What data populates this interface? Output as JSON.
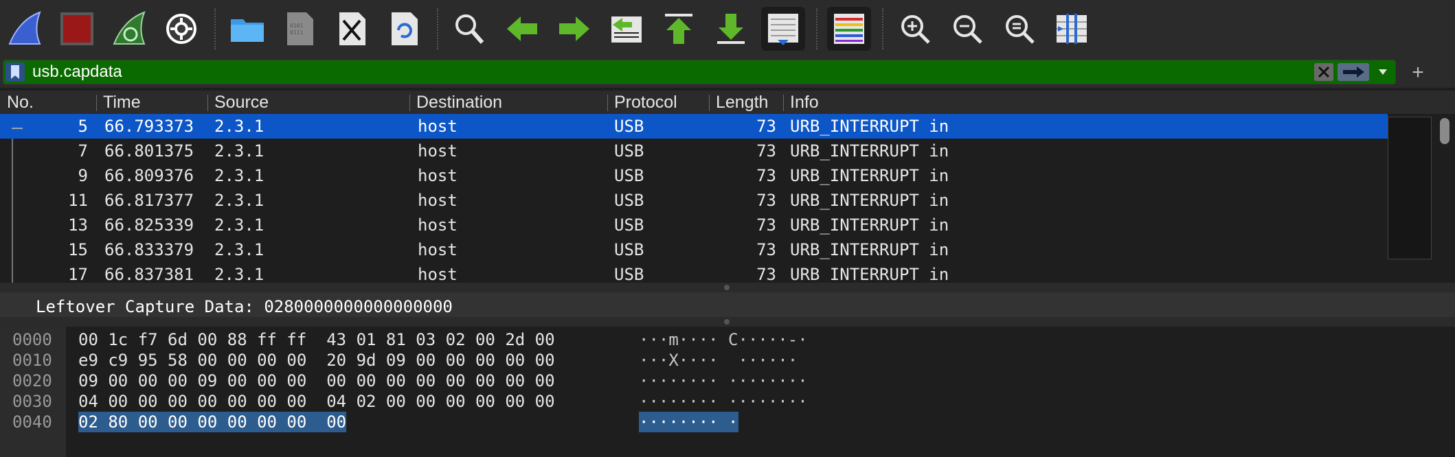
{
  "toolbar": {
    "buttons": [
      {
        "name": "start-capture-icon",
        "label": "Start capture"
      },
      {
        "name": "stop-capture-icon",
        "label": "Stop capture"
      },
      {
        "name": "restart-capture-icon",
        "label": "Restart capture"
      },
      {
        "name": "capture-options-icon",
        "label": "Capture options"
      },
      {
        "name": "open-file-icon",
        "label": "Open"
      },
      {
        "name": "save-file-icon",
        "label": "Save"
      },
      {
        "name": "close-file-icon",
        "label": "Close"
      },
      {
        "name": "reload-file-icon",
        "label": "Reload"
      },
      {
        "name": "find-packet-icon",
        "label": "Find packet"
      },
      {
        "name": "go-back-icon",
        "label": "Previous"
      },
      {
        "name": "go-forward-icon",
        "label": "Next"
      },
      {
        "name": "go-to-packet-icon",
        "label": "Go to packet"
      },
      {
        "name": "go-first-icon",
        "label": "First packet"
      },
      {
        "name": "go-last-icon",
        "label": "Last packet"
      },
      {
        "name": "autoscroll-icon",
        "label": "Auto scroll"
      },
      {
        "name": "colorize-icon",
        "label": "Colorize"
      },
      {
        "name": "zoom-in-icon",
        "label": "Zoom in"
      },
      {
        "name": "zoom-out-icon",
        "label": "Zoom out"
      },
      {
        "name": "zoom-reset-icon",
        "label": "Normal size"
      },
      {
        "name": "resize-columns-icon",
        "label": "Resize columns"
      }
    ]
  },
  "filter": {
    "value": "usb.capdata",
    "bg_color": "#0a6a00"
  },
  "packet_list": {
    "columns": [
      "No.",
      "Time",
      "Source",
      "Destination",
      "Protocol",
      "Length",
      "Info"
    ],
    "rows": [
      {
        "no": "5",
        "time": "66.793373",
        "source": "2.3.1",
        "destination": "host",
        "protocol": "USB",
        "length": "73",
        "info": "URB_INTERRUPT in",
        "selected": true
      },
      {
        "no": "7",
        "time": "66.801375",
        "source": "2.3.1",
        "destination": "host",
        "protocol": "USB",
        "length": "73",
        "info": "URB_INTERRUPT in",
        "selected": false
      },
      {
        "no": "9",
        "time": "66.809376",
        "source": "2.3.1",
        "destination": "host",
        "protocol": "USB",
        "length": "73",
        "info": "URB_INTERRUPT in",
        "selected": false
      },
      {
        "no": "11",
        "time": "66.817377",
        "source": "2.3.1",
        "destination": "host",
        "protocol": "USB",
        "length": "73",
        "info": "URB_INTERRUPT in",
        "selected": false
      },
      {
        "no": "13",
        "time": "66.825339",
        "source": "2.3.1",
        "destination": "host",
        "protocol": "USB",
        "length": "73",
        "info": "URB_INTERRUPT in",
        "selected": false
      },
      {
        "no": "15",
        "time": "66.833379",
        "source": "2.3.1",
        "destination": "host",
        "protocol": "USB",
        "length": "73",
        "info": "URB_INTERRUPT in",
        "selected": false
      },
      {
        "no": "17",
        "time": "66.837381",
        "source": "2.3.1",
        "destination": "host",
        "protocol": "USB",
        "length": "73",
        "info": "URB_INTERRUPT in",
        "selected": false
      }
    ],
    "selected_color": "#0c56c8"
  },
  "details": {
    "line": "Leftover Capture Data: 0280000000000000000"
  },
  "bytes": {
    "rows": [
      {
        "offset": "0000",
        "hex": "00 1c f7 6d 00 88 ff ff  43 01 81 03 02 00 2d 00",
        "ascii": "···m···· C·····-·",
        "hl_hex": "",
        "hl_ascii": ""
      },
      {
        "offset": "0010",
        "hex": "e9 c9 95 58 00 00 00 00  20 9d 09 00 00 00 00 00",
        "ascii": "···X····  ······",
        "hl_hex": "",
        "hl_ascii": ""
      },
      {
        "offset": "0020",
        "hex": "09 00 00 00 09 00 00 00  00 00 00 00 00 00 00 00",
        "ascii": "········ ········",
        "hl_hex": "",
        "hl_ascii": ""
      },
      {
        "offset": "0030",
        "hex": "04 00 00 00 00 00 00 00  04 02 00 00 00 00 00 00",
        "ascii": "········ ········",
        "hl_hex": "",
        "hl_ascii": ""
      },
      {
        "offset": "0040",
        "hex": "",
        "ascii": "",
        "hl_hex": "02 80 00 00 00 00 00 00  00",
        "hl_ascii": "········ ·"
      }
    ],
    "highlight_color": "#2d5c8e"
  }
}
